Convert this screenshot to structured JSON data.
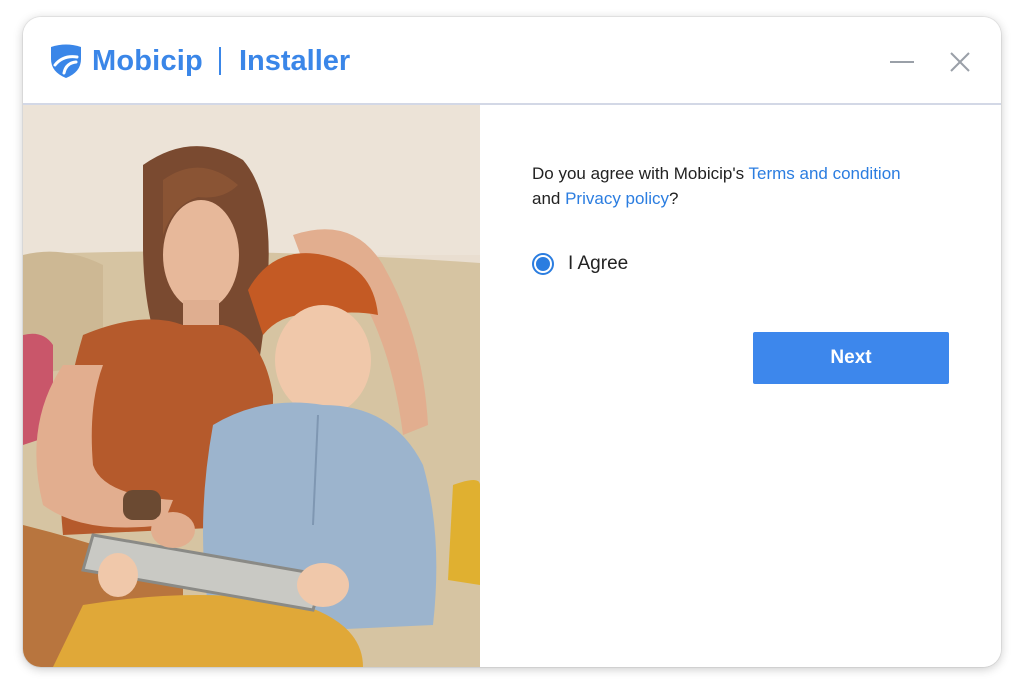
{
  "app": {
    "brand_name": "Mobicip",
    "window_title": "Installer"
  },
  "window_controls": {
    "minimize_icon": "minimize-icon",
    "close_icon": "close-icon"
  },
  "terms": {
    "question_prefix": "Do you agree with Mobicip's ",
    "terms_link": "Terms and condition",
    "and_text": "and ",
    "privacy_link": "Privacy policy",
    "question_suffix": "?"
  },
  "agree_option": {
    "label": "I Agree",
    "selected": true
  },
  "actions": {
    "next_label": "Next"
  },
  "image": {
    "subject": "mother-and-son-using-tablet-on-couch"
  },
  "colors": {
    "accent": "#3a86e8",
    "link": "#2b7de0",
    "button": "#3d87ec"
  }
}
